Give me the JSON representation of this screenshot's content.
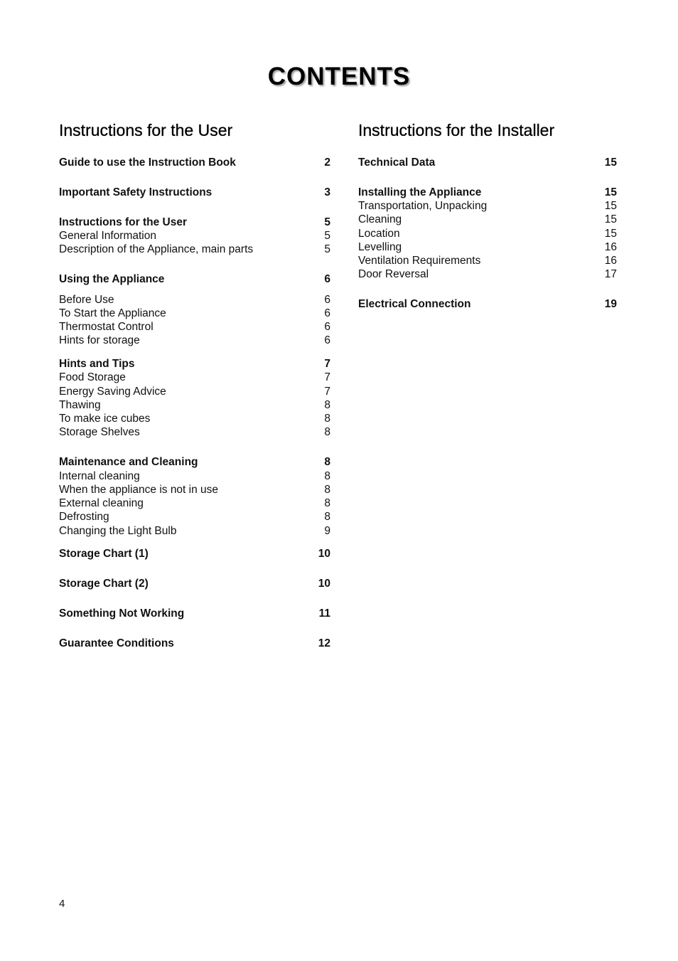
{
  "title": "CONTENTS",
  "user_column": {
    "heading": "Instructions for the User",
    "entries": [
      {
        "label": "Guide to use the Instruction Book",
        "page": "2",
        "bold": true
      },
      {
        "label": "Important Safety Instructions",
        "page": "3",
        "bold": true
      },
      {
        "label": "Instructions for the User",
        "page": "5",
        "bold": true
      },
      {
        "label": "General Information",
        "page": "5",
        "bold": false
      },
      {
        "label": "Description of the Appliance, main parts",
        "page": "5",
        "bold": false
      },
      {
        "label": "Using the Appliance",
        "page": "6",
        "bold": true
      },
      {
        "label": "Before Use",
        "page": "6",
        "bold": false
      },
      {
        "label": "To Start the Appliance",
        "page": "6",
        "bold": false
      },
      {
        "label": "Thermostat Control",
        "page": "6",
        "bold": false
      },
      {
        "label": "Hints for storage",
        "page": "6",
        "bold": false
      },
      {
        "label": "Hints and Tips",
        "page": "7",
        "bold": true
      },
      {
        "label": "Food Storage",
        "page": "7",
        "bold": false
      },
      {
        "label": "Energy Saving Advice",
        "page": "7",
        "bold": false
      },
      {
        "label": "Thawing",
        "page": "8",
        "bold": false
      },
      {
        "label": "To make ice cubes",
        "page": "8",
        "bold": false
      },
      {
        "label": "Storage Shelves",
        "page": "8",
        "bold": false
      },
      {
        "label": "Maintenance and Cleaning",
        "page": "8",
        "bold": true
      },
      {
        "label": "Internal cleaning",
        "page": "8",
        "bold": false
      },
      {
        "label": "When the appliance is not in use",
        "page": "8",
        "bold": false
      },
      {
        "label": "External cleaning",
        "page": "8",
        "bold": false
      },
      {
        "label": "Defrosting",
        "page": "8",
        "bold": false
      },
      {
        "label": "Changing the Light Bulb",
        "page": "9",
        "bold": false
      },
      {
        "label": "Storage Chart (1)",
        "page": "10",
        "bold": true
      },
      {
        "label": "Storage Chart (2)",
        "page": "10",
        "bold": true
      },
      {
        "label": "Something Not Working",
        "page": "11",
        "bold": true
      },
      {
        "label": "Guarantee Conditions",
        "page": "12",
        "bold": true
      }
    ]
  },
  "installer_column": {
    "heading": "Instructions for the Installer",
    "entries": [
      {
        "label": "Technical Data",
        "page": "15",
        "bold": true
      },
      {
        "label": "Installing the Appliance",
        "page": "15",
        "bold": true
      },
      {
        "label": "Transportation, Unpacking",
        "page": "15",
        "bold": false
      },
      {
        "label": "Cleaning",
        "page": "15",
        "bold": false
      },
      {
        "label": "Location",
        "page": "15",
        "bold": false
      },
      {
        "label": "Levelling",
        "page": "16",
        "bold": false
      },
      {
        "label": "Ventilation Requirements",
        "page": "16",
        "bold": false
      },
      {
        "label": "Door Reversal",
        "page": "17",
        "bold": false
      },
      {
        "label": "Electrical Connection",
        "page": "19",
        "bold": true
      }
    ]
  },
  "footer": {
    "page_number": "4"
  }
}
